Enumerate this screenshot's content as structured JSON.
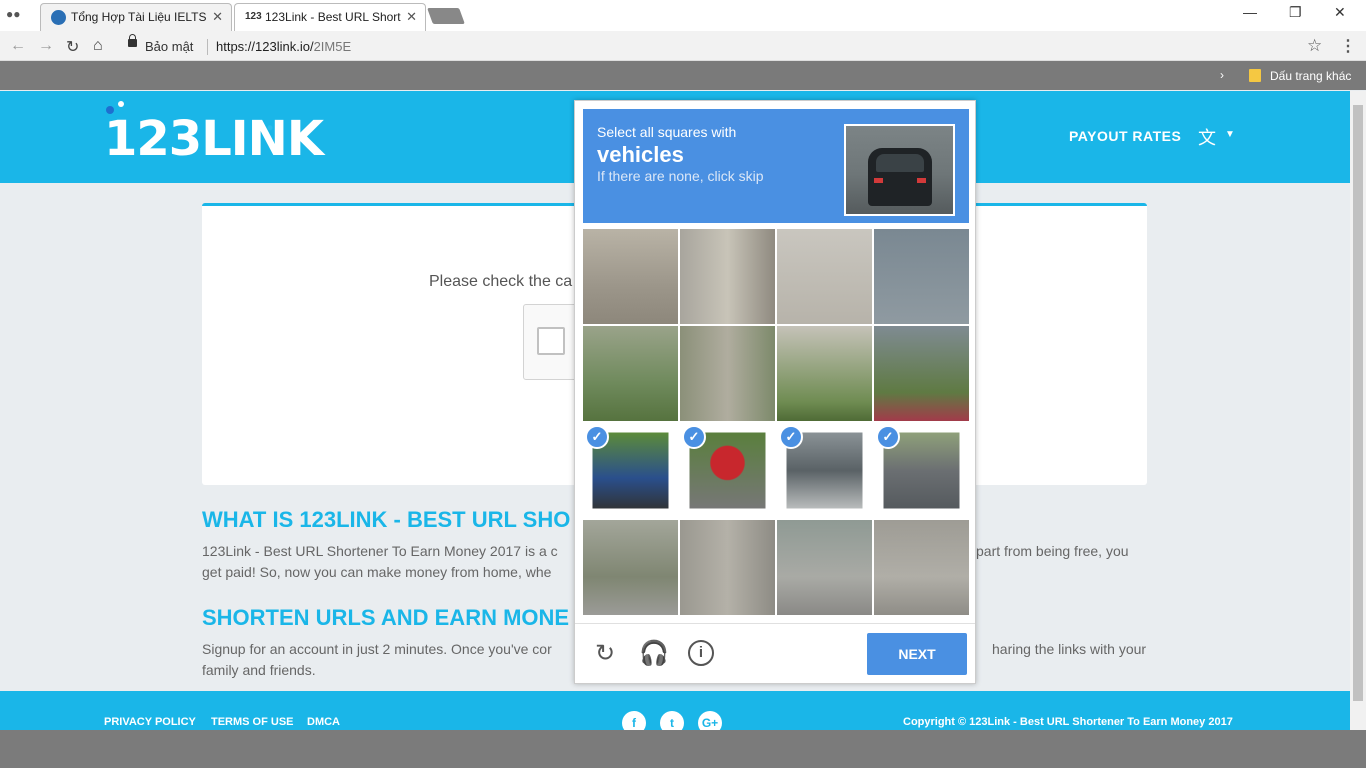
{
  "browser": {
    "tabs": [
      {
        "title": "Tổng Hợp Tài Liệu IELTS"
      },
      {
        "title": "123Link - Best URL Short"
      }
    ],
    "tab2_favicon": "123",
    "close_glyph": "✕",
    "secure_label": "Bảo mật",
    "url_host": "https://123link.io/",
    "url_path": "2IM5E",
    "bookmark_other": "Dấu trang khác"
  },
  "site": {
    "logo_text": "123LINK",
    "nav": {
      "payout_rates": "PAYOUT RATES"
    },
    "check_text": "Please check the ca",
    "sections": [
      {
        "heading": "WHAT IS 123LINK - BEST URL SHO",
        "text": "123Link - Best URL Shortener To Earn Money 2017 is a c",
        "text_right": "part from being free, you",
        "text2": "get paid! So, now you can make money from home, whe"
      },
      {
        "heading": "SHORTEN URLS AND EARN MONE",
        "text": "Signup for an account in just 2 minutes. Once you've cor",
        "text_right": "haring the links with your",
        "text2": "family and friends."
      }
    ],
    "footer": {
      "links": [
        "PRIVACY POLICY",
        "TERMS OF USE",
        "DMCA"
      ],
      "social": [
        "f",
        "t",
        "G+"
      ],
      "copyright": "Copyright © 123Link - Best URL Shortener To Earn Money 2017"
    }
  },
  "captcha": {
    "instruction": "Select all squares with",
    "target": "vehicles",
    "hint": "If there are none, click skip",
    "selected_tiles": [
      8,
      9,
      10,
      11
    ],
    "next_label": "NEXT",
    "icons": [
      "reload-icon",
      "audio-icon",
      "info-icon"
    ]
  }
}
